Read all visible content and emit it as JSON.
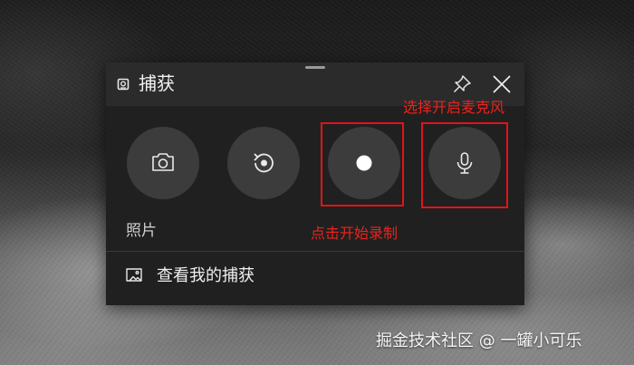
{
  "capture_widget": {
    "title": "捕获",
    "title_icon": "capture-widget-icon",
    "pin_icon": "pin-icon",
    "close_icon": "close-icon",
    "buttons": [
      {
        "name": "screenshot",
        "icon": "camera-icon"
      },
      {
        "name": "record-last-30s",
        "icon": "record-last-icon"
      },
      {
        "name": "start-recording",
        "icon": "record-dot-icon"
      },
      {
        "name": "microphone",
        "icon": "microphone-icon"
      }
    ],
    "photo_label": "照片",
    "gallery_link": {
      "icon": "gallery-icon",
      "label": "查看我的捕获"
    }
  },
  "annotations": {
    "mic_note": "选择开启麦克风",
    "record_note": "点击开始录制",
    "color": "#e0141a"
  },
  "watermark": "掘金技术社区 @ 一罐小可乐",
  "colors": {
    "panel_bg": "#202020",
    "titlebar_bg": "#2b2b2b",
    "button_bg": "#3c3c3c",
    "annotation_red": "#e0141a"
  }
}
